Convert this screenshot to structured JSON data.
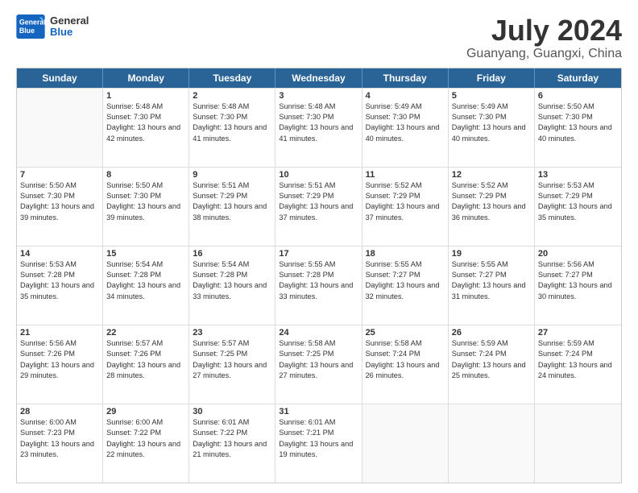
{
  "header": {
    "logo_line1": "General",
    "logo_line2": "Blue",
    "month_year": "July 2024",
    "location": "Guanyang, Guangxi, China"
  },
  "weekdays": [
    "Sunday",
    "Monday",
    "Tuesday",
    "Wednesday",
    "Thursday",
    "Friday",
    "Saturday"
  ],
  "weeks": [
    [
      {
        "day": "",
        "sunrise": "",
        "sunset": "",
        "daylight": ""
      },
      {
        "day": "1",
        "sunrise": "Sunrise: 5:48 AM",
        "sunset": "Sunset: 7:30 PM",
        "daylight": "Daylight: 13 hours and 42 minutes."
      },
      {
        "day": "2",
        "sunrise": "Sunrise: 5:48 AM",
        "sunset": "Sunset: 7:30 PM",
        "daylight": "Daylight: 13 hours and 41 minutes."
      },
      {
        "day": "3",
        "sunrise": "Sunrise: 5:48 AM",
        "sunset": "Sunset: 7:30 PM",
        "daylight": "Daylight: 13 hours and 41 minutes."
      },
      {
        "day": "4",
        "sunrise": "Sunrise: 5:49 AM",
        "sunset": "Sunset: 7:30 PM",
        "daylight": "Daylight: 13 hours and 40 minutes."
      },
      {
        "day": "5",
        "sunrise": "Sunrise: 5:49 AM",
        "sunset": "Sunset: 7:30 PM",
        "daylight": "Daylight: 13 hours and 40 minutes."
      },
      {
        "day": "6",
        "sunrise": "Sunrise: 5:50 AM",
        "sunset": "Sunset: 7:30 PM",
        "daylight": "Daylight: 13 hours and 40 minutes."
      }
    ],
    [
      {
        "day": "7",
        "sunrise": "Sunrise: 5:50 AM",
        "sunset": "Sunset: 7:30 PM",
        "daylight": "Daylight: 13 hours and 39 minutes."
      },
      {
        "day": "8",
        "sunrise": "Sunrise: 5:50 AM",
        "sunset": "Sunset: 7:30 PM",
        "daylight": "Daylight: 13 hours and 39 minutes."
      },
      {
        "day": "9",
        "sunrise": "Sunrise: 5:51 AM",
        "sunset": "Sunset: 7:29 PM",
        "daylight": "Daylight: 13 hours and 38 minutes."
      },
      {
        "day": "10",
        "sunrise": "Sunrise: 5:51 AM",
        "sunset": "Sunset: 7:29 PM",
        "daylight": "Daylight: 13 hours and 37 minutes."
      },
      {
        "day": "11",
        "sunrise": "Sunrise: 5:52 AM",
        "sunset": "Sunset: 7:29 PM",
        "daylight": "Daylight: 13 hours and 37 minutes."
      },
      {
        "day": "12",
        "sunrise": "Sunrise: 5:52 AM",
        "sunset": "Sunset: 7:29 PM",
        "daylight": "Daylight: 13 hours and 36 minutes."
      },
      {
        "day": "13",
        "sunrise": "Sunrise: 5:53 AM",
        "sunset": "Sunset: 7:29 PM",
        "daylight": "Daylight: 13 hours and 35 minutes."
      }
    ],
    [
      {
        "day": "14",
        "sunrise": "Sunrise: 5:53 AM",
        "sunset": "Sunset: 7:28 PM",
        "daylight": "Daylight: 13 hours and 35 minutes."
      },
      {
        "day": "15",
        "sunrise": "Sunrise: 5:54 AM",
        "sunset": "Sunset: 7:28 PM",
        "daylight": "Daylight: 13 hours and 34 minutes."
      },
      {
        "day": "16",
        "sunrise": "Sunrise: 5:54 AM",
        "sunset": "Sunset: 7:28 PM",
        "daylight": "Daylight: 13 hours and 33 minutes."
      },
      {
        "day": "17",
        "sunrise": "Sunrise: 5:55 AM",
        "sunset": "Sunset: 7:28 PM",
        "daylight": "Daylight: 13 hours and 33 minutes."
      },
      {
        "day": "18",
        "sunrise": "Sunrise: 5:55 AM",
        "sunset": "Sunset: 7:27 PM",
        "daylight": "Daylight: 13 hours and 32 minutes."
      },
      {
        "day": "19",
        "sunrise": "Sunrise: 5:55 AM",
        "sunset": "Sunset: 7:27 PM",
        "daylight": "Daylight: 13 hours and 31 minutes."
      },
      {
        "day": "20",
        "sunrise": "Sunrise: 5:56 AM",
        "sunset": "Sunset: 7:27 PM",
        "daylight": "Daylight: 13 hours and 30 minutes."
      }
    ],
    [
      {
        "day": "21",
        "sunrise": "Sunrise: 5:56 AM",
        "sunset": "Sunset: 7:26 PM",
        "daylight": "Daylight: 13 hours and 29 minutes."
      },
      {
        "day": "22",
        "sunrise": "Sunrise: 5:57 AM",
        "sunset": "Sunset: 7:26 PM",
        "daylight": "Daylight: 13 hours and 28 minutes."
      },
      {
        "day": "23",
        "sunrise": "Sunrise: 5:57 AM",
        "sunset": "Sunset: 7:25 PM",
        "daylight": "Daylight: 13 hours and 27 minutes."
      },
      {
        "day": "24",
        "sunrise": "Sunrise: 5:58 AM",
        "sunset": "Sunset: 7:25 PM",
        "daylight": "Daylight: 13 hours and 27 minutes."
      },
      {
        "day": "25",
        "sunrise": "Sunrise: 5:58 AM",
        "sunset": "Sunset: 7:24 PM",
        "daylight": "Daylight: 13 hours and 26 minutes."
      },
      {
        "day": "26",
        "sunrise": "Sunrise: 5:59 AM",
        "sunset": "Sunset: 7:24 PM",
        "daylight": "Daylight: 13 hours and 25 minutes."
      },
      {
        "day": "27",
        "sunrise": "Sunrise: 5:59 AM",
        "sunset": "Sunset: 7:24 PM",
        "daylight": "Daylight: 13 hours and 24 minutes."
      }
    ],
    [
      {
        "day": "28",
        "sunrise": "Sunrise: 6:00 AM",
        "sunset": "Sunset: 7:23 PM",
        "daylight": "Daylight: 13 hours and 23 minutes."
      },
      {
        "day": "29",
        "sunrise": "Sunrise: 6:00 AM",
        "sunset": "Sunset: 7:22 PM",
        "daylight": "Daylight: 13 hours and 22 minutes."
      },
      {
        "day": "30",
        "sunrise": "Sunrise: 6:01 AM",
        "sunset": "Sunset: 7:22 PM",
        "daylight": "Daylight: 13 hours and 21 minutes."
      },
      {
        "day": "31",
        "sunrise": "Sunrise: 6:01 AM",
        "sunset": "Sunset: 7:21 PM",
        "daylight": "Daylight: 13 hours and 19 minutes."
      },
      {
        "day": "",
        "sunrise": "",
        "sunset": "",
        "daylight": ""
      },
      {
        "day": "",
        "sunrise": "",
        "sunset": "",
        "daylight": ""
      },
      {
        "day": "",
        "sunrise": "",
        "sunset": "",
        "daylight": ""
      }
    ]
  ]
}
